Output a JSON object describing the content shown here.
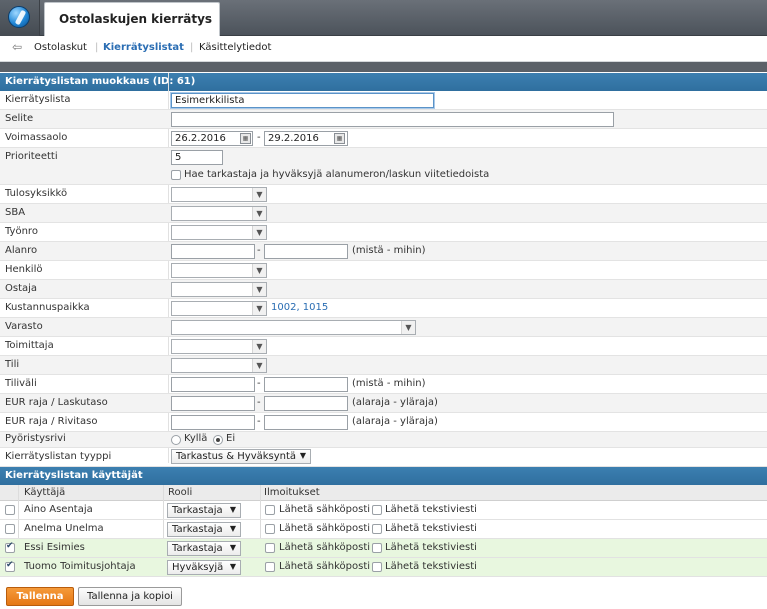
{
  "app": {
    "title": "Ostolaskujen kierrätys"
  },
  "nav": {
    "items": [
      "Ostolaskut",
      "Kierrätyslistat",
      "Käsittelytiedot"
    ],
    "active": "Kierrätyslistat"
  },
  "form": {
    "section_title": "Kierrätyslistan muokkaus (ID: 61)",
    "fields": {
      "kierratyslista": {
        "label": "Kierrätyslista",
        "value": "Esimerkkilista"
      },
      "selite": {
        "label": "Selite",
        "value": ""
      },
      "voimassaolo": {
        "label": "Voimassaolo",
        "from": "26.2.2016",
        "to": "29.2.2016"
      },
      "prioriteetti": {
        "label": "Prioriteetti",
        "value": "5"
      },
      "hae_checkbox": {
        "label": "Hae tarkastaja ja hyväksyjä alanumeron/laskun viitetiedoista",
        "checked": false
      },
      "tulosyksikko": {
        "label": "Tulosyksikkö"
      },
      "sba": {
        "label": "SBA"
      },
      "tyonro": {
        "label": "Työnro"
      },
      "alanro": {
        "label": "Alanro",
        "hint": "(mistä - mihin)"
      },
      "henkilo": {
        "label": "Henkilö"
      },
      "ostaja": {
        "label": "Ostaja"
      },
      "kustannuspaikka": {
        "label": "Kustannuspaikka",
        "link": "1002, 1015"
      },
      "varasto": {
        "label": "Varasto"
      },
      "toimittaja": {
        "label": "Toimittaja"
      },
      "tili": {
        "label": "Tili"
      },
      "tilivali": {
        "label": "Tiliväli",
        "hint": "(mistä - mihin)"
      },
      "eur_laskutaso": {
        "label": "EUR raja / Laskutaso",
        "hint": "(alaraja - yläraja)"
      },
      "eur_rivitaso": {
        "label": "EUR raja / Rivitaso",
        "hint": "(alaraja - yläraja)"
      },
      "pyoristysrivi": {
        "label": "Pyöristysrivi",
        "options": [
          "Kyllä",
          "Ei"
        ],
        "selected": "Ei"
      },
      "tyyppi": {
        "label": "Kierrätyslistan tyyppi",
        "value": "Tarkastus & Hyväksyntä"
      }
    },
    "dash": "-"
  },
  "users": {
    "section_title": "Kierrätyslistan käyttäjät",
    "columns": [
      "Käyttäjä",
      "Rooli",
      "Ilmoitukset"
    ],
    "email_label": "Lähetä sähköposti",
    "sms_label": "Lähetä tekstiviesti",
    "rows": [
      {
        "name": "Aino Asentaja",
        "role": "Tarkastaja",
        "checked": false
      },
      {
        "name": "Anelma Unelma",
        "role": "Tarkastaja",
        "checked": false
      },
      {
        "name": "Essi Esimies",
        "role": "Tarkastaja",
        "checked": true
      },
      {
        "name": "Tuomo Toimitusjohtaja",
        "role": "Hyväksyjä",
        "checked": true
      }
    ]
  },
  "buttons": {
    "save": "Tallenna",
    "save_copy": "Tallenna ja kopioi"
  },
  "colors": {
    "header_blue": "#2f6f9f",
    "accent_orange": "#e57714",
    "selected_row": "#e8f7df",
    "link": "#2a6db3"
  }
}
